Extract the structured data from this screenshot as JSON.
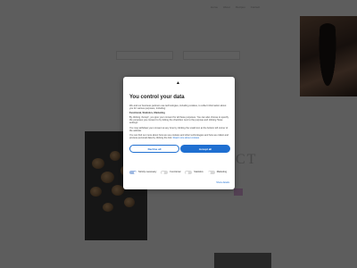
{
  "background": {
    "nav": [
      "Home",
      "About",
      "Recipes",
      "Contact"
    ],
    "heading": "CT"
  },
  "consent": {
    "logo_glyph": "▲",
    "title": "You control your data",
    "intro": "We and our business partners use technologies, including cookies, to collect information about you for various purposes, including:",
    "purposes": "Functional, Statistics, Marketing",
    "paragraph1": "By clicking 'Accept', you give your consent for all these purposes. You can also choose to specify the purposes you consent to by ticking the checkbox next to the purpose and clicking 'Save settings'.",
    "paragraph2": "You may withdraw your consent at any time by clicking the small icon at the bottom left corner of the website.",
    "paragraph3": "You can find out more about how we use cookies and other technologies and how we collect and process personal data by clicking the link.",
    "read_more": "Read more about cookies",
    "decline_label": "Decline all",
    "accept_label": "Accept all",
    "toggles": [
      {
        "label": "Strictly necessary",
        "on": true
      },
      {
        "label": "Functional",
        "on": false
      },
      {
        "label": "Statistics",
        "on": false
      },
      {
        "label": "Marketing",
        "on": false
      }
    ],
    "show_details": "Show details"
  }
}
